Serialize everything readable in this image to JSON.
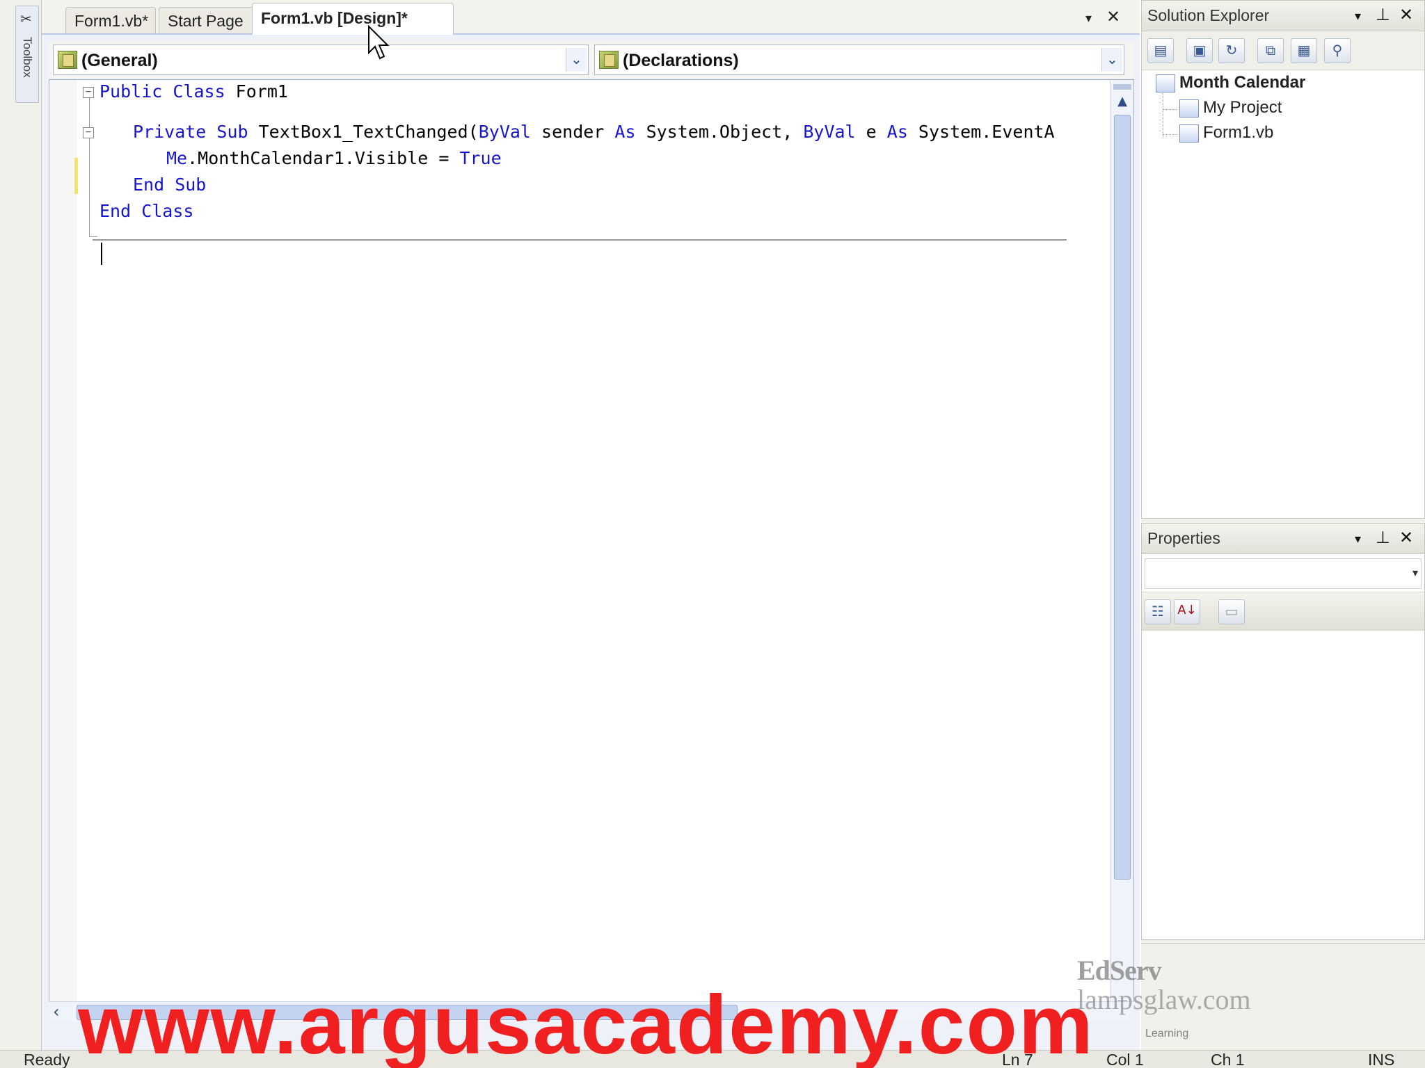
{
  "toolbox": {
    "label": "Toolbox",
    "icon": "toolbox-icon"
  },
  "tabs": [
    {
      "label": "Form1.vb*",
      "active": false
    },
    {
      "label": "Start Page",
      "active": false
    },
    {
      "label": "Form1.vb [Design]*",
      "active": true
    }
  ],
  "tab_controls": {
    "dropdown": "▾",
    "close": "✕"
  },
  "navbar": {
    "class_combo": "(General)",
    "member_combo": "(Declarations)",
    "arrow": "⌄"
  },
  "code": {
    "line1": {
      "kw1": "Public Class",
      "rest": " Form1"
    },
    "line3": {
      "kw1": "Private Sub",
      "t1": " TextBox1_TextChanged(",
      "kw2": "ByVal",
      "t2": " sender ",
      "kw3": "As",
      "t3": " System.Object, ",
      "kw4": "ByVal",
      "t4": " e ",
      "kw5": "As",
      "t5": " System.EventA"
    },
    "line4": {
      "kw1": "Me",
      "t1": ".MonthCalendar1.Visible = ",
      "kw2": "True"
    },
    "line5": {
      "kw1": "End Sub"
    },
    "line6": {
      "kw1": "End Class"
    },
    "fold_collapse": "−"
  },
  "solution_explorer": {
    "title": "Solution Explorer",
    "controls": {
      "dropdown": "▾",
      "pin": "⊥",
      "close": "✕"
    },
    "toolbar_icons": [
      "properties-icon",
      "show-all-files-icon",
      "refresh-icon",
      "view-code-icon",
      "view-designer-icon",
      "class-diagram-icon"
    ],
    "toolbar_glyphs": [
      "▤",
      "▣",
      "↻",
      "⧉",
      "▦",
      "⚲"
    ],
    "tree": [
      {
        "label": "Month Calendar",
        "bold": true
      },
      {
        "label": "My Project",
        "bold": false
      },
      {
        "label": "Form1.vb",
        "bold": false
      }
    ]
  },
  "properties": {
    "title": "Properties",
    "controls": {
      "dropdown": "▾",
      "pin": "⊥",
      "close": "✕"
    },
    "combo_arrow": "▾",
    "toolbar_glyphs": [
      "☷",
      "A↓",
      "▭"
    ]
  },
  "status": {
    "text": "Ready",
    "line": "Ln 7",
    "col": "Col 1",
    "ch": "Ch 1",
    "mode": "INS"
  },
  "watermark": {
    "logo": "EdServ",
    "site": "lampsglaw.com",
    "learning": "Learning",
    "banner": "www.argusacademy.com"
  },
  "colors": {
    "keyword": "#1515cc",
    "banner": "#f02020",
    "scroll_thumb": "#c4d3ef"
  }
}
